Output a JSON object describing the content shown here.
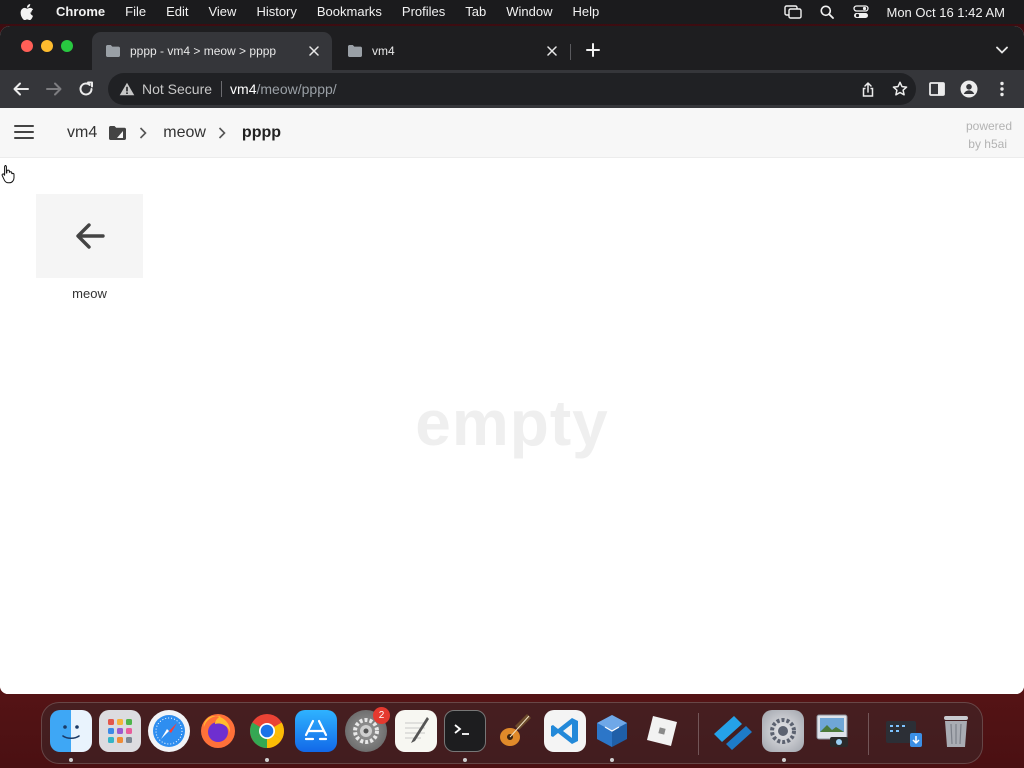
{
  "menubar": {
    "app": "Chrome",
    "items": [
      "File",
      "Edit",
      "View",
      "History",
      "Bookmarks",
      "Profiles",
      "Tab",
      "Window",
      "Help"
    ],
    "clock": "Mon Oct 16  1:42 AM"
  },
  "tabs": [
    {
      "title": "pppp - vm4 > meow > pppp",
      "active": true
    },
    {
      "title": "vm4",
      "active": false
    }
  ],
  "omnibox": {
    "security": "Not Secure",
    "host": "vm4",
    "path": "/meow/pppp/"
  },
  "page": {
    "breadcrumbs": [
      "vm4",
      "meow",
      "pppp"
    ],
    "powered_line1": "powered",
    "powered_line2": "by h5ai",
    "parent_item_label": "meow",
    "empty_text": "empty"
  },
  "dock": {
    "apps": [
      "Finder",
      "Launchpad",
      "Safari",
      "Firefox",
      "Google Chrome",
      "App Store",
      "System Preferences",
      "TextEdit",
      "Terminal",
      "GarageBand",
      "Visual Studio Code",
      "VirtualBox",
      "Roblox",
      "Roblox Studio",
      "System Preferences",
      "Preview",
      "Downloads",
      "Trash"
    ],
    "settings_badge": "2"
  },
  "colors": {
    "menubar_bg": "#1b1b1d",
    "tabstrip_bg": "#1e1e20",
    "toolbar_bg": "#35363a",
    "omnibox_bg": "#202124",
    "h5ai_topbar_bg": "#f7f7f7",
    "empty_text": "#efefef"
  }
}
